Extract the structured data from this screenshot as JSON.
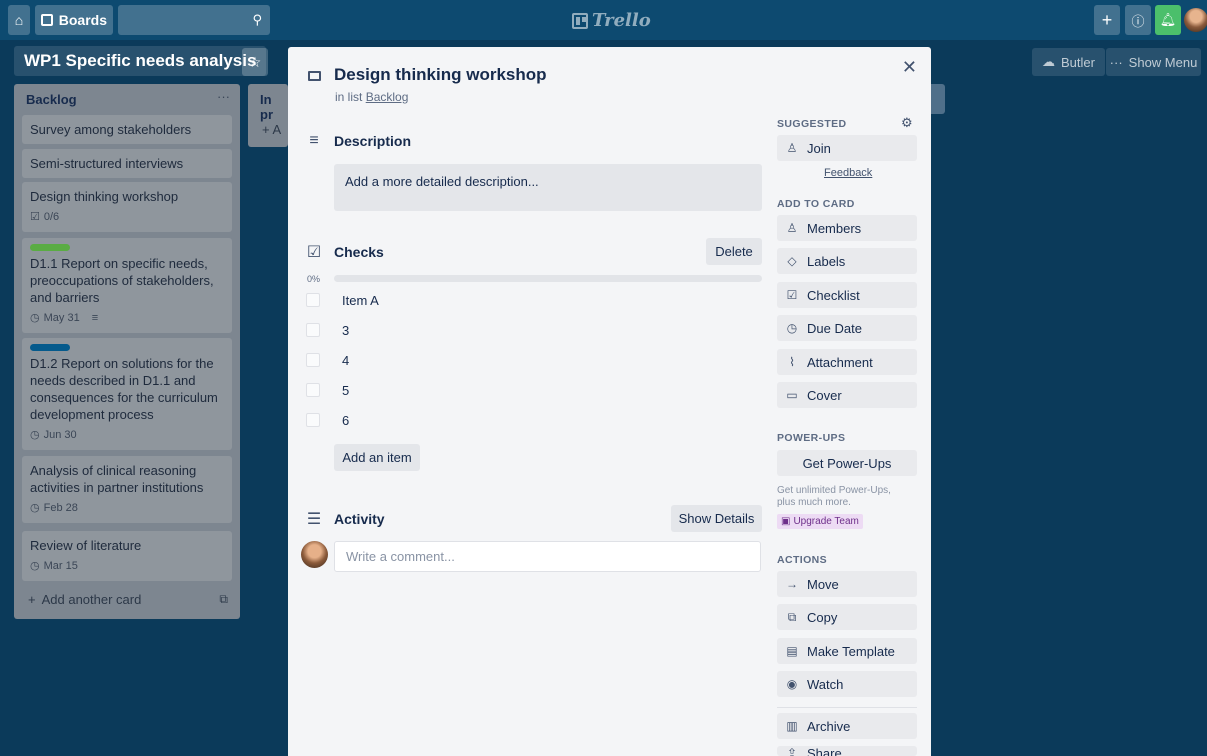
{
  "header": {
    "boards_label": "Boards",
    "logo_text": "Trello"
  },
  "board": {
    "title": "WP1 Specific needs analysis",
    "butler_label": "Butler",
    "show_menu_label": "Show Menu"
  },
  "lists": {
    "backlog": {
      "title": "Backlog",
      "cards": [
        {
          "title": "Survey among stakeholders"
        },
        {
          "title": "Semi-structured interviews"
        },
        {
          "title": "Design thinking workshop",
          "checklist": "0/6"
        },
        {
          "title": "D1.1 Report on specific needs, preoccupations of stakeholders, and barriers",
          "due": "May 31",
          "label_color": "#5aac44"
        },
        {
          "title": "D1.2 Report on solutions for the needs described in D1.1 and consequences for the curriculum development process",
          "due": "Jun 30",
          "label_color": "#055a8c"
        },
        {
          "title": "Analysis of clinical reasoning activities in partner institutions",
          "due": "Feb 28"
        },
        {
          "title": "Review of literature",
          "due": "Mar 15"
        }
      ],
      "add_card_label": "Add another card"
    },
    "in_progress": {
      "title": "In pr",
      "add_label": "+ A"
    }
  },
  "modal": {
    "title": "Design thinking workshop",
    "in_list_prefix": "in list",
    "in_list_name": "Backlog",
    "description_title": "Description",
    "description_placeholder": "Add a more detailed description...",
    "checklist_title": "Checks",
    "delete_label": "Delete",
    "progress_percent": "0%",
    "progress_value": 0,
    "checklist_items": [
      "Item A",
      "3",
      "4",
      "5",
      "6"
    ],
    "add_item_label": "Add an item",
    "activity_title": "Activity",
    "show_details_label": "Show Details",
    "comment_placeholder": "Write a comment..."
  },
  "sidebar": {
    "suggested_heading": "SUGGESTED",
    "join_label": "Join",
    "feedback_label": "Feedback",
    "add_to_card_heading": "ADD TO CARD",
    "add_to_card": [
      "Members",
      "Labels",
      "Checklist",
      "Due Date",
      "Attachment",
      "Cover"
    ],
    "power_ups_heading": "POWER-UPS",
    "get_power_ups_label": "Get Power-Ups",
    "power_ups_desc_1": "Get unlimited Power-Ups,",
    "power_ups_desc_2": "plus much more.",
    "upgrade_label": "Upgrade Team",
    "actions_heading": "ACTIONS",
    "actions": [
      "Move",
      "Copy",
      "Make Template",
      "Watch",
      "Archive",
      "Share"
    ]
  }
}
